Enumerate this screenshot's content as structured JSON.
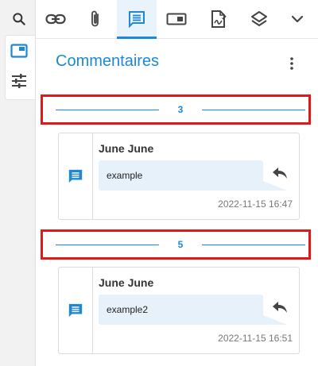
{
  "colors": {
    "accent": "#1e88d6",
    "highlight_border": "#e01818"
  },
  "left_rail": {
    "items": [
      {
        "icon": "search-icon"
      },
      {
        "icon": "panel-toggle-icon",
        "active": true
      },
      {
        "icon": "sliders-icon"
      }
    ]
  },
  "tabs": [
    {
      "icon": "link-icon"
    },
    {
      "icon": "paperclip-icon"
    },
    {
      "icon": "comment-icon",
      "active": true
    },
    {
      "icon": "tag-icon"
    },
    {
      "icon": "document-sign-icon"
    },
    {
      "icon": "layers-icon"
    },
    {
      "icon": "chevron-down-icon"
    }
  ],
  "panel": {
    "title": "Commentaires"
  },
  "threads": [
    {
      "number": "3",
      "comment": {
        "author": "June June",
        "text": "example",
        "timestamp": "2022-11-15 16:47"
      }
    },
    {
      "number": "5",
      "comment": {
        "author": "June June",
        "text": "example2",
        "timestamp": "2022-11-15 16:51"
      }
    }
  ]
}
